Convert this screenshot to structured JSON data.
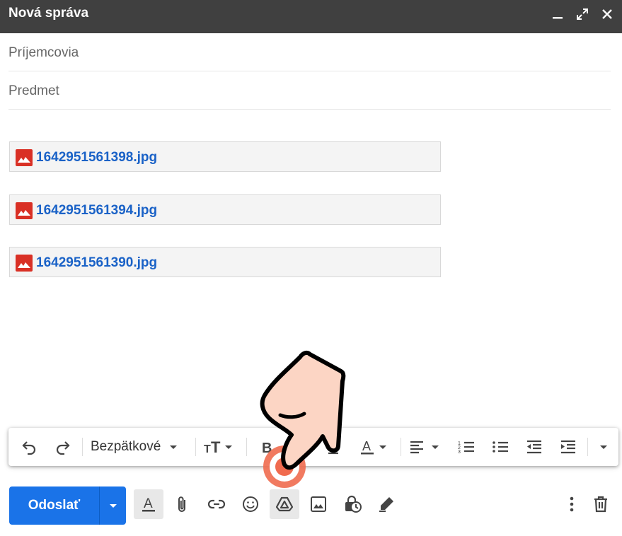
{
  "window": {
    "title": "Nová správa"
  },
  "recipients": {
    "placeholder": "Príjemcovia"
  },
  "subject": {
    "placeholder": "Predmet"
  },
  "attachments": [
    {
      "name": "1642951561398.jpg"
    },
    {
      "name": "1642951561394.jpg"
    },
    {
      "name": "1642951561390.jpg"
    }
  ],
  "format_toolbar": {
    "font_family": "Bezpätkové",
    "buttons": [
      "undo-icon",
      "redo-icon",
      "font-size-icon",
      "bold-icon",
      "italic-icon",
      "underline-icon",
      "text-color-icon",
      "align-icon",
      "numbered-list-icon",
      "bulleted-list-icon",
      "indent-less-icon",
      "indent-more-icon",
      "more-formatting-icon"
    ]
  },
  "bottom_toolbar": {
    "send_label": "Odoslať",
    "icons": [
      "formatting-options-icon",
      "attach-file-icon",
      "insert-link-icon",
      "emoji-icon",
      "google-drive-icon",
      "insert-photo-icon",
      "confidential-mode-icon",
      "signature-icon",
      "more-options-icon",
      "discard-icon"
    ]
  },
  "colors": {
    "accent": "#1a73e8",
    "titlebar": "#404040",
    "link": "#1a62c7",
    "attachment_icon": "#d93025",
    "pointer_ring": "#f06b4f",
    "pointer_fill": "#fcd5c4"
  }
}
